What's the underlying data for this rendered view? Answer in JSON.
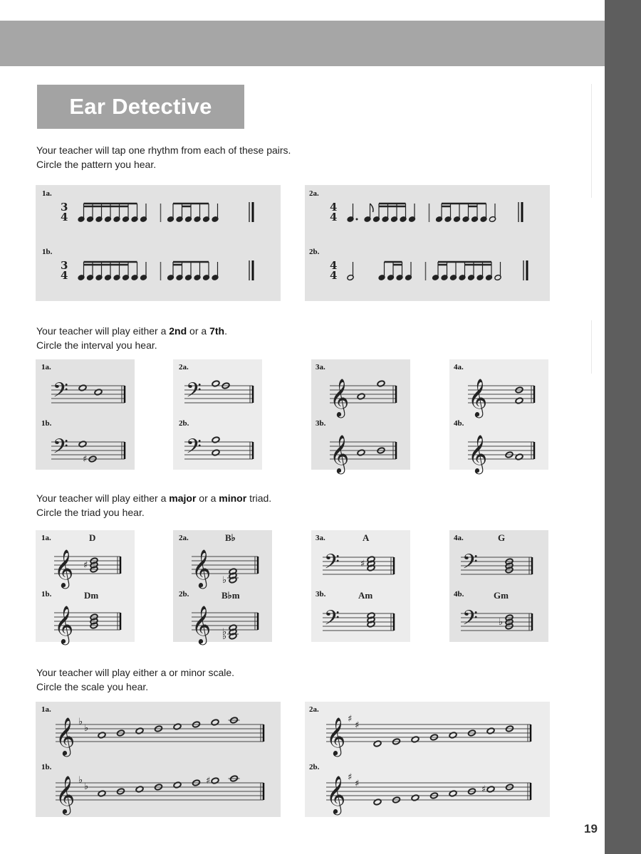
{
  "page": {
    "title": "Ear Detective",
    "page_number": "19",
    "colors": {
      "band": "#a6a6a6",
      "side_strip": "#5e5e5e",
      "panel_dark": "#e2e2e2",
      "panel_light": "#ececec",
      "title_text": "#ffffff"
    }
  },
  "sections": {
    "rhythm": {
      "line1": "Your teacher will tap one rhythm from each of these pairs.",
      "line2": "Circle the pattern you hear.",
      "items": [
        {
          "label": "1a.",
          "time_signature": "3/4"
        },
        {
          "label": "1b.",
          "time_signature": "3/4"
        },
        {
          "label": "2a.",
          "time_signature": "4/4"
        },
        {
          "label": "2b.",
          "time_signature": "4/4"
        }
      ]
    },
    "interval": {
      "line1_pre": "Your teacher will play either a ",
      "line1_b1": "2nd",
      "line1_mid": " or a ",
      "line1_b2": "7th",
      "line1_post": ".",
      "line2": "Circle the interval you hear.",
      "items": [
        {
          "label": "1a.",
          "clef": "bass"
        },
        {
          "label": "1b.",
          "clef": "bass"
        },
        {
          "label": "2a.",
          "clef": "bass"
        },
        {
          "label": "2b.",
          "clef": "bass"
        },
        {
          "label": "3a.",
          "clef": "treble"
        },
        {
          "label": "3b.",
          "clef": "treble"
        },
        {
          "label": "4a.",
          "clef": "treble"
        },
        {
          "label": "4b.",
          "clef": "treble"
        }
      ]
    },
    "triad": {
      "line1_pre": "Your teacher will play either a ",
      "line1_b1": "major",
      "line1_mid": " or a ",
      "line1_b2": "minor",
      "line1_post": " triad.",
      "line2": "Circle the triad you hear.",
      "items": [
        {
          "label": "1a.",
          "chord": "D",
          "clef": "treble"
        },
        {
          "label": "1b.",
          "chord": "Dm",
          "clef": "treble"
        },
        {
          "label": "2a.",
          "chord": "B♭",
          "clef": "treble"
        },
        {
          "label": "2b.",
          "chord": "B♭m",
          "clef": "treble"
        },
        {
          "label": "3a.",
          "chord": "A",
          "clef": "bass"
        },
        {
          "label": "3b.",
          "chord": "Am",
          "clef": "bass"
        },
        {
          "label": "4a.",
          "chord": "G",
          "clef": "bass"
        },
        {
          "label": "4b.",
          "chord": "Gm",
          "clef": "bass"
        }
      ]
    },
    "scale": {
      "line1": "Your teacher will play either a  or  minor scale.",
      "line2": "Circle the scale you hear.",
      "items": [
        {
          "label": "1a.",
          "key_signature": "2 flats"
        },
        {
          "label": "1b.",
          "key_signature": "2 flats"
        },
        {
          "label": "2a.",
          "key_signature": "2 sharps"
        },
        {
          "label": "2b.",
          "key_signature": "2 sharps"
        }
      ]
    }
  }
}
